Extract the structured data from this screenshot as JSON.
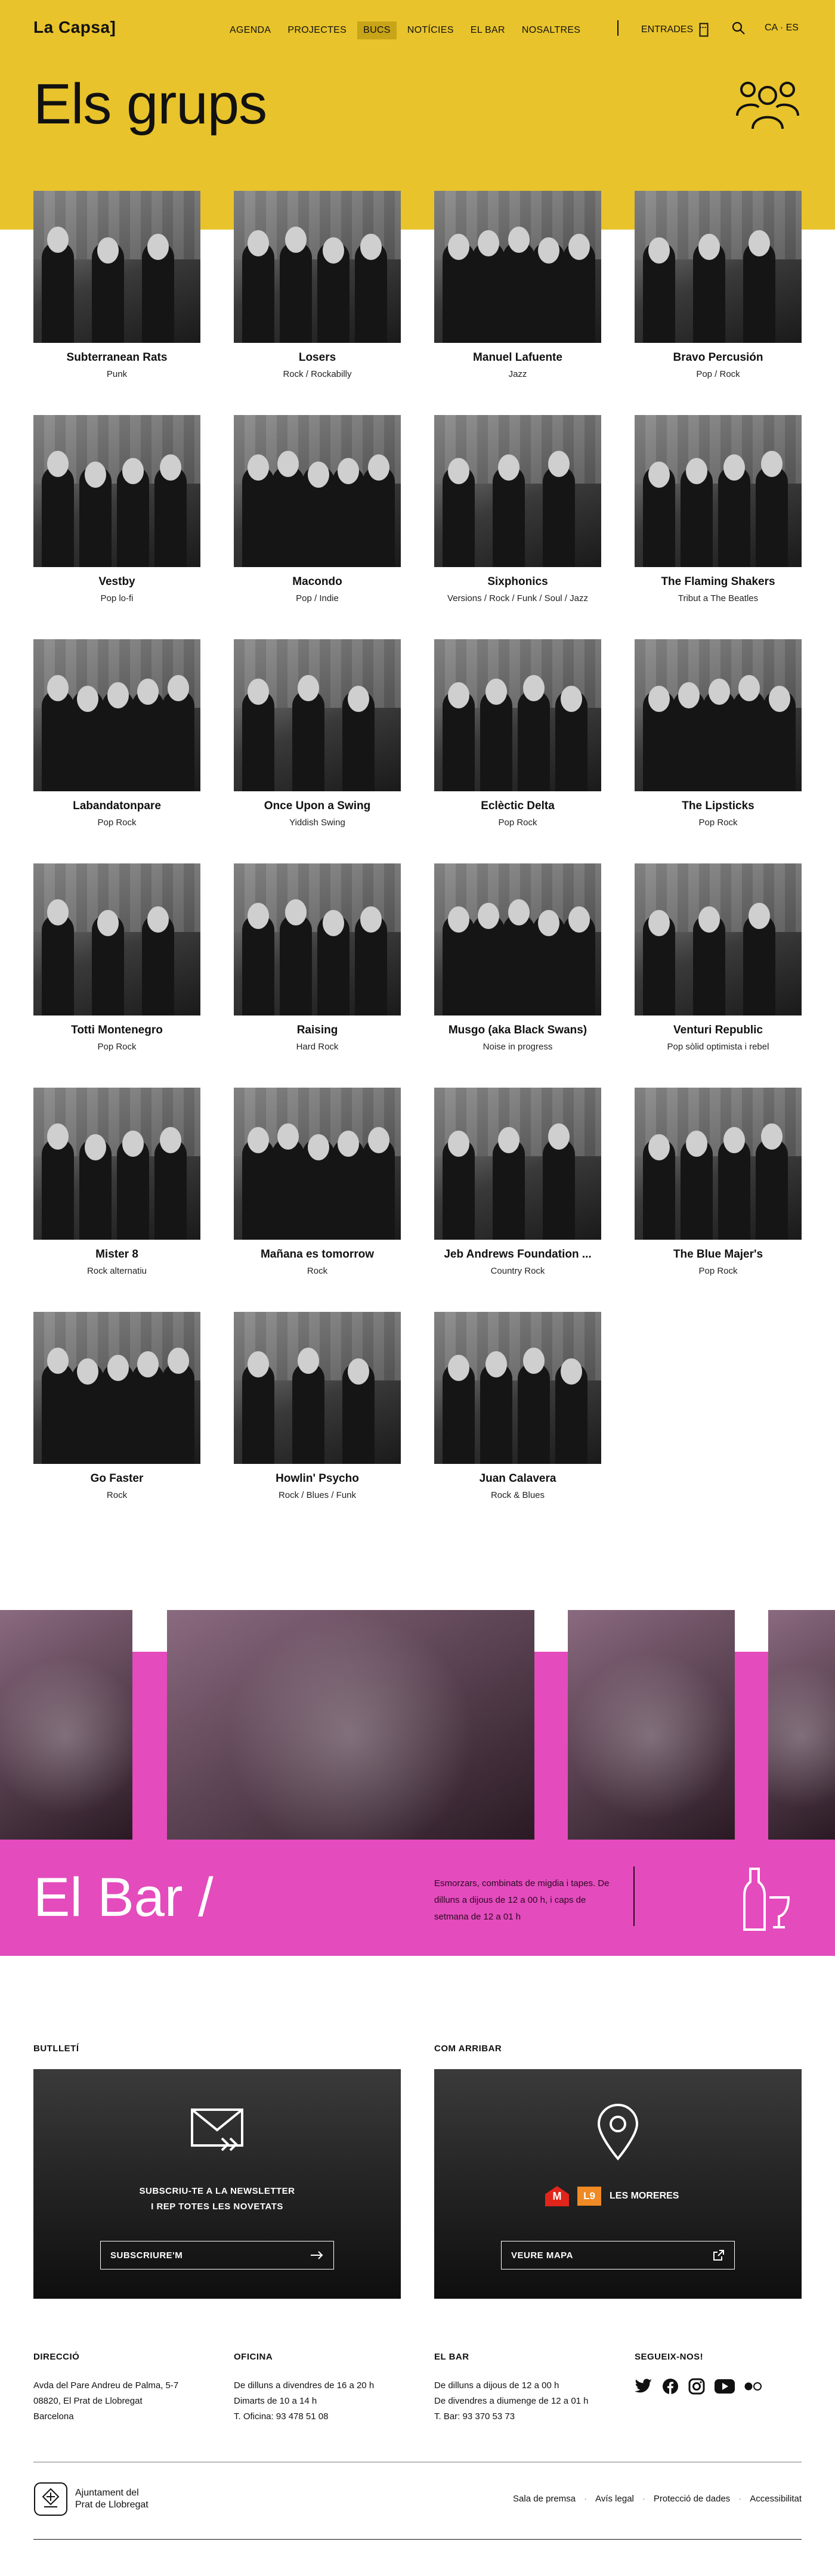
{
  "header": {
    "logo": "La Capsa]",
    "nav": [
      {
        "label": "AGENDA"
      },
      {
        "label": "PROJECTES"
      },
      {
        "label": "BUCS",
        "active": true
      },
      {
        "label": "NOTÍCIES"
      },
      {
        "label": "EL BAR"
      },
      {
        "label": "NOSALTRES"
      }
    ],
    "tickets_label": "ENTRADES",
    "lang_ca": "CA",
    "lang_sep": "·",
    "lang_es": "ES",
    "accent_color": "#e8c32b"
  },
  "page": {
    "title": "Els grups"
  },
  "groups": [
    {
      "name": "Subterranean Rats",
      "genre": "Punk"
    },
    {
      "name": "Losers",
      "genre": "Rock / Rockabilly"
    },
    {
      "name": "Manuel Lafuente",
      "genre": "Jazz"
    },
    {
      "name": "Bravo Percusión",
      "genre": "Pop / Rock"
    },
    {
      "name": "Vestby",
      "genre": "Pop lo-fi"
    },
    {
      "name": "Macondo",
      "genre": "Pop / Indie"
    },
    {
      "name": "Sixphonics",
      "genre": "Versions / Rock / Funk / Soul / Jazz"
    },
    {
      "name": "The Flaming Shakers",
      "genre": "Tribut a The Beatles"
    },
    {
      "name": "Labandatonpare",
      "genre": "Pop Rock"
    },
    {
      "name": "Once Upon a Swing",
      "genre": "Yiddish Swing"
    },
    {
      "name": "Eclèctic Delta",
      "genre": "Pop Rock"
    },
    {
      "name": "The Lipsticks",
      "genre": "Pop Rock"
    },
    {
      "name": "Totti Montenegro",
      "genre": "Pop Rock"
    },
    {
      "name": "Raising",
      "genre": "Hard Rock"
    },
    {
      "name": "Musgo (aka Black Swans)",
      "genre": "Noise in progress"
    },
    {
      "name": "Venturi Republic",
      "genre": "Pop sòlid optimista i rebel"
    },
    {
      "name": "Mister 8",
      "genre": "Rock alternatiu"
    },
    {
      "name": "Mañana es tomorrow",
      "genre": "Rock"
    },
    {
      "name": "Jeb Andrews Foundation ...",
      "genre": "Country Rock"
    },
    {
      "name": "The Blue Majer's",
      "genre": "Pop Rock"
    },
    {
      "name": "Go Faster",
      "genre": "Rock"
    },
    {
      "name": "Howlin' Psycho",
      "genre": "Rock / Blues / Funk"
    },
    {
      "name": "Juan Calavera",
      "genre": "Rock & Blues"
    }
  ],
  "bar": {
    "title": "El Bar /",
    "text": "Esmorzars, combinats de migdia i tapes. De dilluns a dijous de 12 a 00 h, i caps de setmana de 12 a 01 h",
    "color": "#e44bbd",
    "icon": "bottle-glass-icon"
  },
  "newsletter": {
    "heading": "BUTLLETÍ",
    "text_line1": "SUBSCRIU-TE A LA NEWSLETTER",
    "text_line2": "I REP TOTES LES NOVETATS",
    "button": "SUBSCRIURE'M"
  },
  "directions": {
    "heading": "COM ARRIBAR",
    "metro_badge": "M",
    "line_badge": "L9",
    "stop": "LES MORERES",
    "button": "VEURE MAPA"
  },
  "footer": {
    "address": {
      "heading": "DIRECCIÓ",
      "lines": [
        "Avda del Pare Andreu de Palma, 5-7",
        "08820, El Prat de Llobregat",
        "Barcelona"
      ]
    },
    "office": {
      "heading": "OFICINA",
      "lines": [
        "De dilluns a divendres de 16 a 20 h",
        "Dimarts de 10 a 14 h",
        "T. Oficina: 93 478 51 08"
      ]
    },
    "bar": {
      "heading": "EL BAR",
      "lines": [
        "De dilluns a dijous de 12 a 00 h",
        "De divendres a diumenge de 12 a 01 h",
        "T. Bar: 93 370 53 73"
      ]
    },
    "follow": {
      "heading": "SEGUEIX-NOS!"
    },
    "council_line1": "Ajuntament del",
    "council_line2": "Prat de Llobregat",
    "legal": [
      "Sala de premsa",
      "Avís legal",
      "Protecció de dades",
      "Accessibilitat"
    ]
  }
}
